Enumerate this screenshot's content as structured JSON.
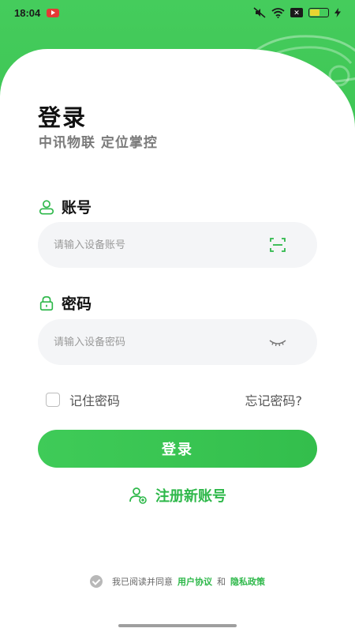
{
  "status_bar": {
    "time": "18:04",
    "sim_label": "✕"
  },
  "login": {
    "title": "登录",
    "subtitle": "中讯物联 定位掌控",
    "account_label": "账号",
    "account_placeholder": "请输入设备账号",
    "account_value": "",
    "password_label": "密码",
    "password_placeholder": "请输入设备密码",
    "password_value": "",
    "remember_label": "记住密码",
    "remember_checked": false,
    "forgot_label": "忘记密码?",
    "login_button": "登录",
    "register_label": "注册新账号"
  },
  "agreement": {
    "prefix": "我已阅读并同意",
    "user_agreement": "用户协议",
    "and": "和",
    "privacy_policy": "隐私政策"
  },
  "colors": {
    "brand_green": "#3cc453",
    "link_green": "#2eb84a",
    "input_bg": "#f4f5f7"
  },
  "icons": {
    "account": "user-icon",
    "password": "lock-icon",
    "scan": "scan-icon",
    "eye": "eye-closed-icon",
    "register": "user-add-icon",
    "agree": "check-circle-icon"
  }
}
